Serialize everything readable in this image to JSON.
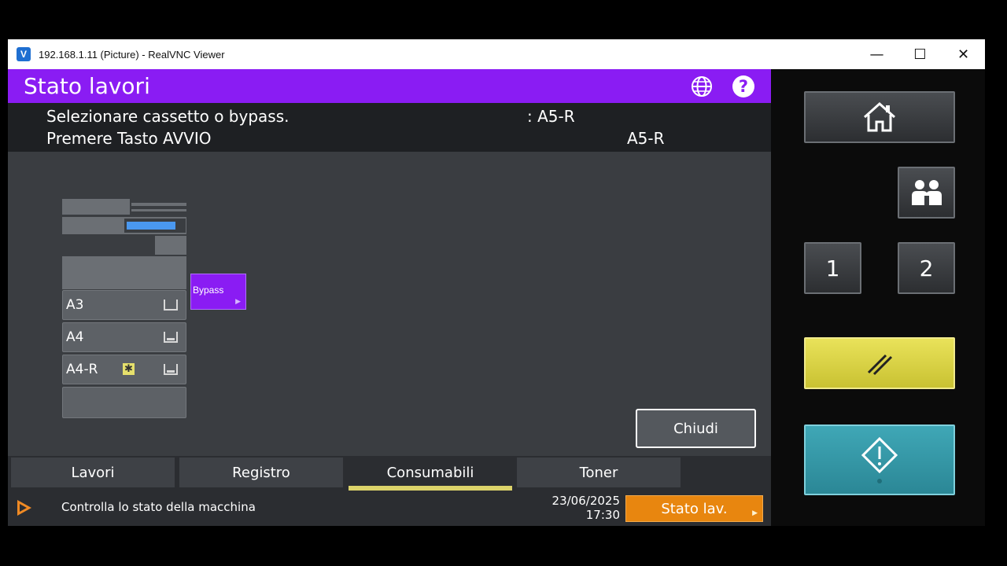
{
  "window": {
    "title": "192.168.1.11 (Picture) - RealVNC Viewer",
    "app_icon": "realvnc-icon",
    "controls": {
      "minimize": "—",
      "maximize": "☐",
      "close": "✕"
    }
  },
  "header": {
    "title": "Stato lavori",
    "help_label": "?",
    "colors": {
      "accent": "#8a1cf3"
    }
  },
  "message": {
    "line1": "Selezionare cassetto o bypass.",
    "line1_value": ": A5-R",
    "line2": "Premere Tasto AVVIO",
    "line2_value": "A5-R"
  },
  "trays": [
    {
      "label": "A3",
      "level": "empty"
    },
    {
      "label": "A4",
      "level": "full"
    },
    {
      "label": "A4-R",
      "level": "full",
      "mark": "✱"
    }
  ],
  "bypass": {
    "label": "Bypass",
    "arrow": "▶"
  },
  "close_button": {
    "label": "Chiudi"
  },
  "tabs": [
    {
      "label": "Lavori"
    },
    {
      "label": "Registro"
    },
    {
      "label": "Consumabili",
      "active": true
    },
    {
      "label": "Toner"
    }
  ],
  "status": {
    "text": "Controlla lo stato della macchina",
    "date": "23/06/2025",
    "time": "17:30",
    "button_label": "Stato lav.",
    "button_arrow": "▶"
  },
  "hardware": {
    "button1": "1",
    "button2": "2",
    "colors": {
      "clear": "#e6df52",
      "start": "#36a0b0"
    }
  }
}
